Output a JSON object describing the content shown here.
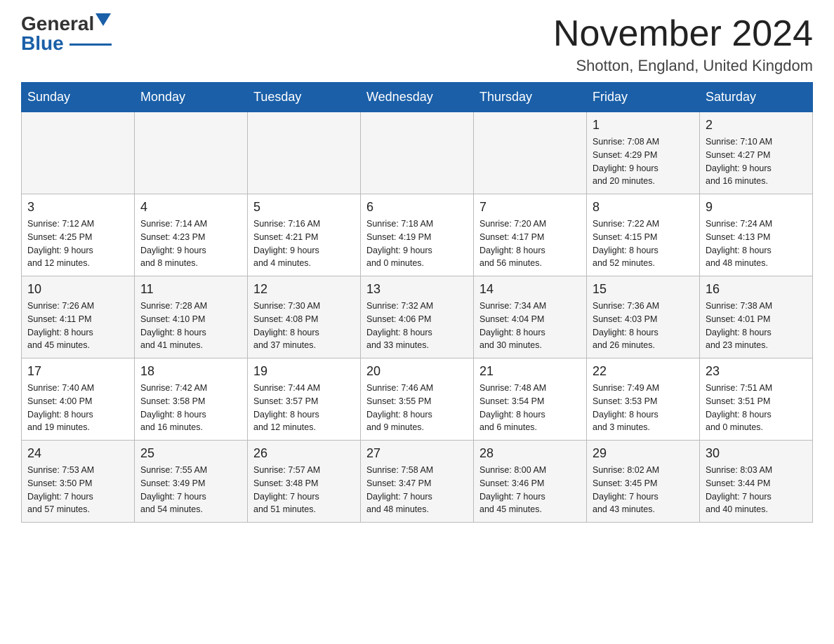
{
  "header": {
    "logo_general": "General",
    "logo_blue": "Blue",
    "month_title": "November 2024",
    "location": "Shotton, England, United Kingdom"
  },
  "weekdays": [
    "Sunday",
    "Monday",
    "Tuesday",
    "Wednesday",
    "Thursday",
    "Friday",
    "Saturday"
  ],
  "weeks": [
    [
      {
        "day": "",
        "info": ""
      },
      {
        "day": "",
        "info": ""
      },
      {
        "day": "",
        "info": ""
      },
      {
        "day": "",
        "info": ""
      },
      {
        "day": "",
        "info": ""
      },
      {
        "day": "1",
        "info": "Sunrise: 7:08 AM\nSunset: 4:29 PM\nDaylight: 9 hours\nand 20 minutes."
      },
      {
        "day": "2",
        "info": "Sunrise: 7:10 AM\nSunset: 4:27 PM\nDaylight: 9 hours\nand 16 minutes."
      }
    ],
    [
      {
        "day": "3",
        "info": "Sunrise: 7:12 AM\nSunset: 4:25 PM\nDaylight: 9 hours\nand 12 minutes."
      },
      {
        "day": "4",
        "info": "Sunrise: 7:14 AM\nSunset: 4:23 PM\nDaylight: 9 hours\nand 8 minutes."
      },
      {
        "day": "5",
        "info": "Sunrise: 7:16 AM\nSunset: 4:21 PM\nDaylight: 9 hours\nand 4 minutes."
      },
      {
        "day": "6",
        "info": "Sunrise: 7:18 AM\nSunset: 4:19 PM\nDaylight: 9 hours\nand 0 minutes."
      },
      {
        "day": "7",
        "info": "Sunrise: 7:20 AM\nSunset: 4:17 PM\nDaylight: 8 hours\nand 56 minutes."
      },
      {
        "day": "8",
        "info": "Sunrise: 7:22 AM\nSunset: 4:15 PM\nDaylight: 8 hours\nand 52 minutes."
      },
      {
        "day": "9",
        "info": "Sunrise: 7:24 AM\nSunset: 4:13 PM\nDaylight: 8 hours\nand 48 minutes."
      }
    ],
    [
      {
        "day": "10",
        "info": "Sunrise: 7:26 AM\nSunset: 4:11 PM\nDaylight: 8 hours\nand 45 minutes."
      },
      {
        "day": "11",
        "info": "Sunrise: 7:28 AM\nSunset: 4:10 PM\nDaylight: 8 hours\nand 41 minutes."
      },
      {
        "day": "12",
        "info": "Sunrise: 7:30 AM\nSunset: 4:08 PM\nDaylight: 8 hours\nand 37 minutes."
      },
      {
        "day": "13",
        "info": "Sunrise: 7:32 AM\nSunset: 4:06 PM\nDaylight: 8 hours\nand 33 minutes."
      },
      {
        "day": "14",
        "info": "Sunrise: 7:34 AM\nSunset: 4:04 PM\nDaylight: 8 hours\nand 30 minutes."
      },
      {
        "day": "15",
        "info": "Sunrise: 7:36 AM\nSunset: 4:03 PM\nDaylight: 8 hours\nand 26 minutes."
      },
      {
        "day": "16",
        "info": "Sunrise: 7:38 AM\nSunset: 4:01 PM\nDaylight: 8 hours\nand 23 minutes."
      }
    ],
    [
      {
        "day": "17",
        "info": "Sunrise: 7:40 AM\nSunset: 4:00 PM\nDaylight: 8 hours\nand 19 minutes."
      },
      {
        "day": "18",
        "info": "Sunrise: 7:42 AM\nSunset: 3:58 PM\nDaylight: 8 hours\nand 16 minutes."
      },
      {
        "day": "19",
        "info": "Sunrise: 7:44 AM\nSunset: 3:57 PM\nDaylight: 8 hours\nand 12 minutes."
      },
      {
        "day": "20",
        "info": "Sunrise: 7:46 AM\nSunset: 3:55 PM\nDaylight: 8 hours\nand 9 minutes."
      },
      {
        "day": "21",
        "info": "Sunrise: 7:48 AM\nSunset: 3:54 PM\nDaylight: 8 hours\nand 6 minutes."
      },
      {
        "day": "22",
        "info": "Sunrise: 7:49 AM\nSunset: 3:53 PM\nDaylight: 8 hours\nand 3 minutes."
      },
      {
        "day": "23",
        "info": "Sunrise: 7:51 AM\nSunset: 3:51 PM\nDaylight: 8 hours\nand 0 minutes."
      }
    ],
    [
      {
        "day": "24",
        "info": "Sunrise: 7:53 AM\nSunset: 3:50 PM\nDaylight: 7 hours\nand 57 minutes."
      },
      {
        "day": "25",
        "info": "Sunrise: 7:55 AM\nSunset: 3:49 PM\nDaylight: 7 hours\nand 54 minutes."
      },
      {
        "day": "26",
        "info": "Sunrise: 7:57 AM\nSunset: 3:48 PM\nDaylight: 7 hours\nand 51 minutes."
      },
      {
        "day": "27",
        "info": "Sunrise: 7:58 AM\nSunset: 3:47 PM\nDaylight: 7 hours\nand 48 minutes."
      },
      {
        "day": "28",
        "info": "Sunrise: 8:00 AM\nSunset: 3:46 PM\nDaylight: 7 hours\nand 45 minutes."
      },
      {
        "day": "29",
        "info": "Sunrise: 8:02 AM\nSunset: 3:45 PM\nDaylight: 7 hours\nand 43 minutes."
      },
      {
        "day": "30",
        "info": "Sunrise: 8:03 AM\nSunset: 3:44 PM\nDaylight: 7 hours\nand 40 minutes."
      }
    ]
  ]
}
